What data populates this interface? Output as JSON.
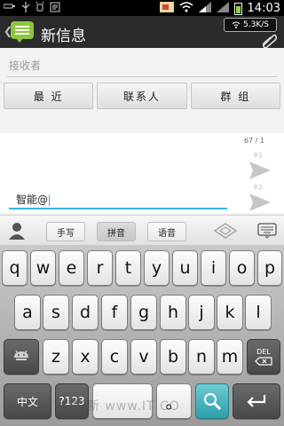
{
  "status_bar": {
    "time": "14:03"
  },
  "action_bar": {
    "title": "新信息",
    "speed": "5.3K/S"
  },
  "recipient": {
    "placeholder": "接收者"
  },
  "buttons": {
    "recent": "最 近",
    "contacts": "联系人",
    "groups": "群 组"
  },
  "compose": {
    "counter": "67 / 1",
    "sim1": "卡1",
    "sim2": "卡2",
    "text": "智能@"
  },
  "ime": {
    "handwrite": "手写",
    "pinyin": "拼音",
    "voice": "语音"
  },
  "keyboard": {
    "row1": [
      "q",
      "w",
      "e",
      "r",
      "t",
      "y",
      "u",
      "i",
      "o",
      "p"
    ],
    "row2": [
      "a",
      "s",
      "d",
      "f",
      "g",
      "h",
      "j",
      "k",
      "l"
    ],
    "row3": [
      "z",
      "x",
      "c",
      "v",
      "b",
      "n",
      "m"
    ],
    "del": "DEL",
    "lang": "中文",
    "sym": "?123",
    "dot": "。"
  },
  "watermark": "(千)新 www.IT  CO"
}
